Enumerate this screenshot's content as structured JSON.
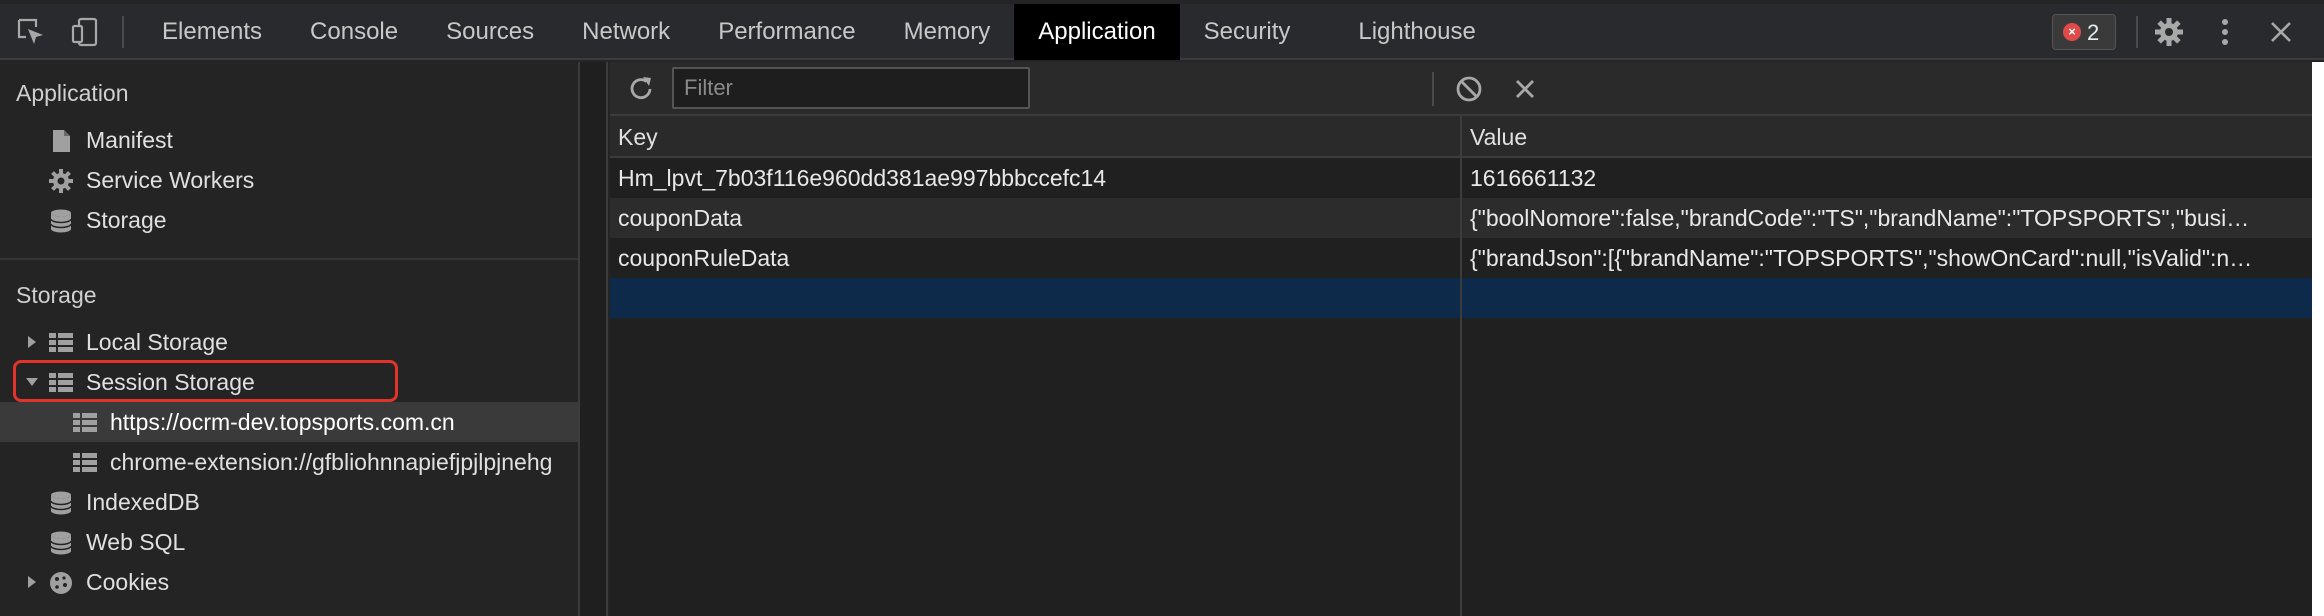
{
  "tabs": [
    {
      "label": "Elements"
    },
    {
      "label": "Console"
    },
    {
      "label": "Sources"
    },
    {
      "label": "Network"
    },
    {
      "label": "Performance"
    },
    {
      "label": "Memory"
    },
    {
      "label": "Application",
      "active": true
    },
    {
      "label": "Security"
    },
    {
      "label": "Lighthouse"
    }
  ],
  "errors": {
    "count": "2"
  },
  "sidebar": {
    "application_title": "Application",
    "application_items": [
      {
        "label": "Manifest",
        "icon": "document-icon"
      },
      {
        "label": "Service Workers",
        "icon": "gear-icon"
      },
      {
        "label": "Storage",
        "icon": "database-icon"
      }
    ],
    "storage_title": "Storage",
    "storage_items": [
      {
        "label": "Local Storage",
        "icon": "grid-icon",
        "expanded": false
      },
      {
        "label": "Session Storage",
        "icon": "grid-icon",
        "expanded": true
      },
      {
        "label": "https://ocrm-dev.topsports.com.cn",
        "icon": "grid-icon",
        "child": true,
        "selected": true
      },
      {
        "label": "chrome-extension://gfbliohnnapiefjpjlpjnehg",
        "icon": "grid-icon",
        "child": true
      },
      {
        "label": "IndexedDB",
        "icon": "database-icon"
      },
      {
        "label": "Web SQL",
        "icon": "database-icon"
      },
      {
        "label": "Cookies",
        "icon": "cookie-icon",
        "expanded": false
      }
    ]
  },
  "toolbar": {
    "filter_placeholder": "Filter",
    "refresh_icon": "refresh-icon",
    "clear_icon": "block-icon",
    "delete_icon": "close-icon"
  },
  "table": {
    "columns": [
      "Key",
      "Value"
    ],
    "rows": [
      {
        "key": "Hm_lpvt_7b03f116e960dd381ae997bbbccefc14",
        "value": "1616661132"
      },
      {
        "key": "couponData",
        "value": "{\"boolNomore\":false,\"brandCode\":\"TS\",\"brandName\":\"TOPSPORTS\",\"busi…"
      },
      {
        "key": "couponRuleData",
        "value": "{\"brandJson\":[{\"brandName\":\"TOPSPORTS\",\"showOnCard\":null,\"isValid\":n…"
      },
      {
        "key": "",
        "value": ""
      }
    ]
  },
  "colors": {
    "active_tab_bg": "#000000",
    "highlight": "#e0342b",
    "selected_row": "#0d2a4a"
  }
}
